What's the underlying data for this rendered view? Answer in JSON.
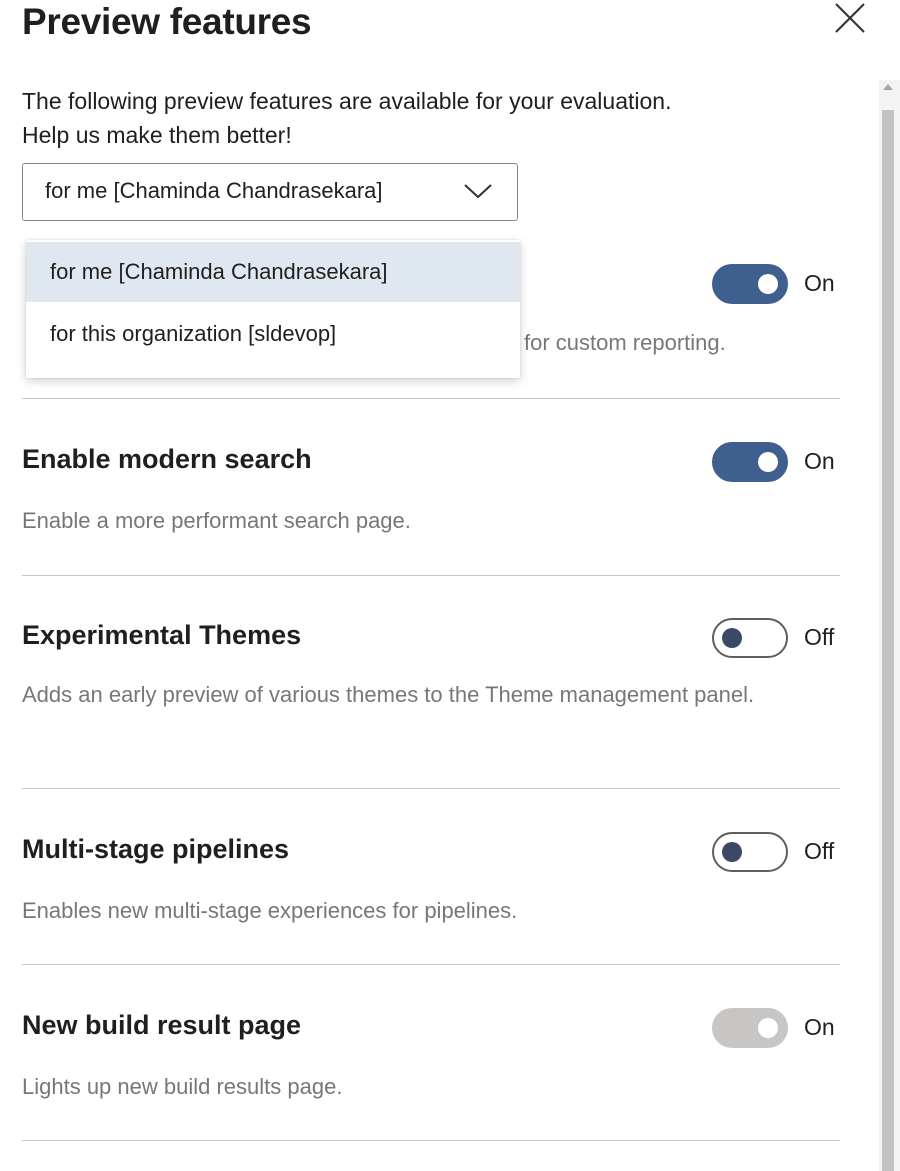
{
  "panel": {
    "title": "Preview features",
    "intro_line1": "The following preview features are available for your evaluation.",
    "intro_line2": "Help us make them better!"
  },
  "scope": {
    "selected": "for me [Chaminda Chandrasekara]",
    "options": [
      "for me [Chaminda Chandrasekara]",
      "for this organization [sldevop]"
    ]
  },
  "partial_feature": {
    "desc_fragment": "for custom reporting.",
    "state": "On",
    "enabled": true
  },
  "features": [
    {
      "name": "Enable modern search",
      "description": "Enable a more performant search page.",
      "state": "On",
      "enabled": true
    },
    {
      "name": "Experimental Themes",
      "description": "Adds an early preview of various themes to the Theme management panel.",
      "state": "Off",
      "enabled": false
    },
    {
      "name": "Multi-stage pipelines",
      "description": "Enables new multi-stage experiences for pipelines.",
      "state": "Off",
      "enabled": false
    },
    {
      "name": "New build result page",
      "description": "Lights up new build results page.",
      "state": "On",
      "enabled": true,
      "locked": true
    }
  ],
  "colors": {
    "toggle_on": "#3f5f8f",
    "toggle_disabled": "#c8c6c4",
    "selected_option_bg": "#dfe8f1"
  }
}
